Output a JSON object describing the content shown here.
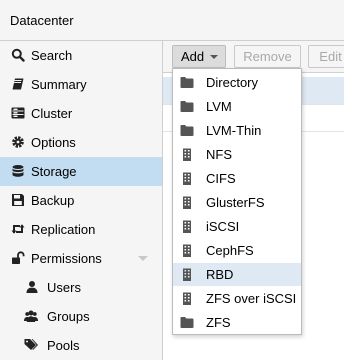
{
  "header": {
    "title": "Datacenter"
  },
  "sidebar": {
    "items": [
      {
        "label": "Search",
        "icon": "search-icon"
      },
      {
        "label": "Summary",
        "icon": "book-icon"
      },
      {
        "label": "Cluster",
        "icon": "server-icon"
      },
      {
        "label": "Options",
        "icon": "gear-icon"
      },
      {
        "label": "Storage",
        "icon": "database-icon",
        "active": true
      },
      {
        "label": "Backup",
        "icon": "floppy-icon"
      },
      {
        "label": "Replication",
        "icon": "retweet-icon"
      },
      {
        "label": "Permissions",
        "icon": "unlock-icon",
        "expanded": true
      },
      {
        "label": "Users",
        "icon": "user-icon"
      },
      {
        "label": "Groups",
        "icon": "users-icon"
      },
      {
        "label": "Pools",
        "icon": "tags-icon"
      }
    ]
  },
  "toolbar": {
    "add_label": "Add",
    "remove_label": "Remove",
    "edit_label": "Edit"
  },
  "add_menu": {
    "items": [
      {
        "label": "Directory",
        "icon": "folder-icon"
      },
      {
        "label": "LVM",
        "icon": "folder-icon"
      },
      {
        "label": "LVM-Thin",
        "icon": "folder-icon"
      },
      {
        "label": "NFS",
        "icon": "building-icon"
      },
      {
        "label": "CIFS",
        "icon": "building-icon"
      },
      {
        "label": "GlusterFS",
        "icon": "building-icon"
      },
      {
        "label": "iSCSI",
        "icon": "building-icon"
      },
      {
        "label": "CephFS",
        "icon": "building-icon"
      },
      {
        "label": "RBD",
        "icon": "building-icon",
        "active": true
      },
      {
        "label": "ZFS over iSCSI",
        "icon": "building-icon"
      },
      {
        "label": "ZFS",
        "icon": "folder-icon"
      }
    ]
  },
  "colors": {
    "selection": "#c2ddf2",
    "hover": "#dfe9f4",
    "panel": "#f5f5f5",
    "icon": "#555555"
  }
}
